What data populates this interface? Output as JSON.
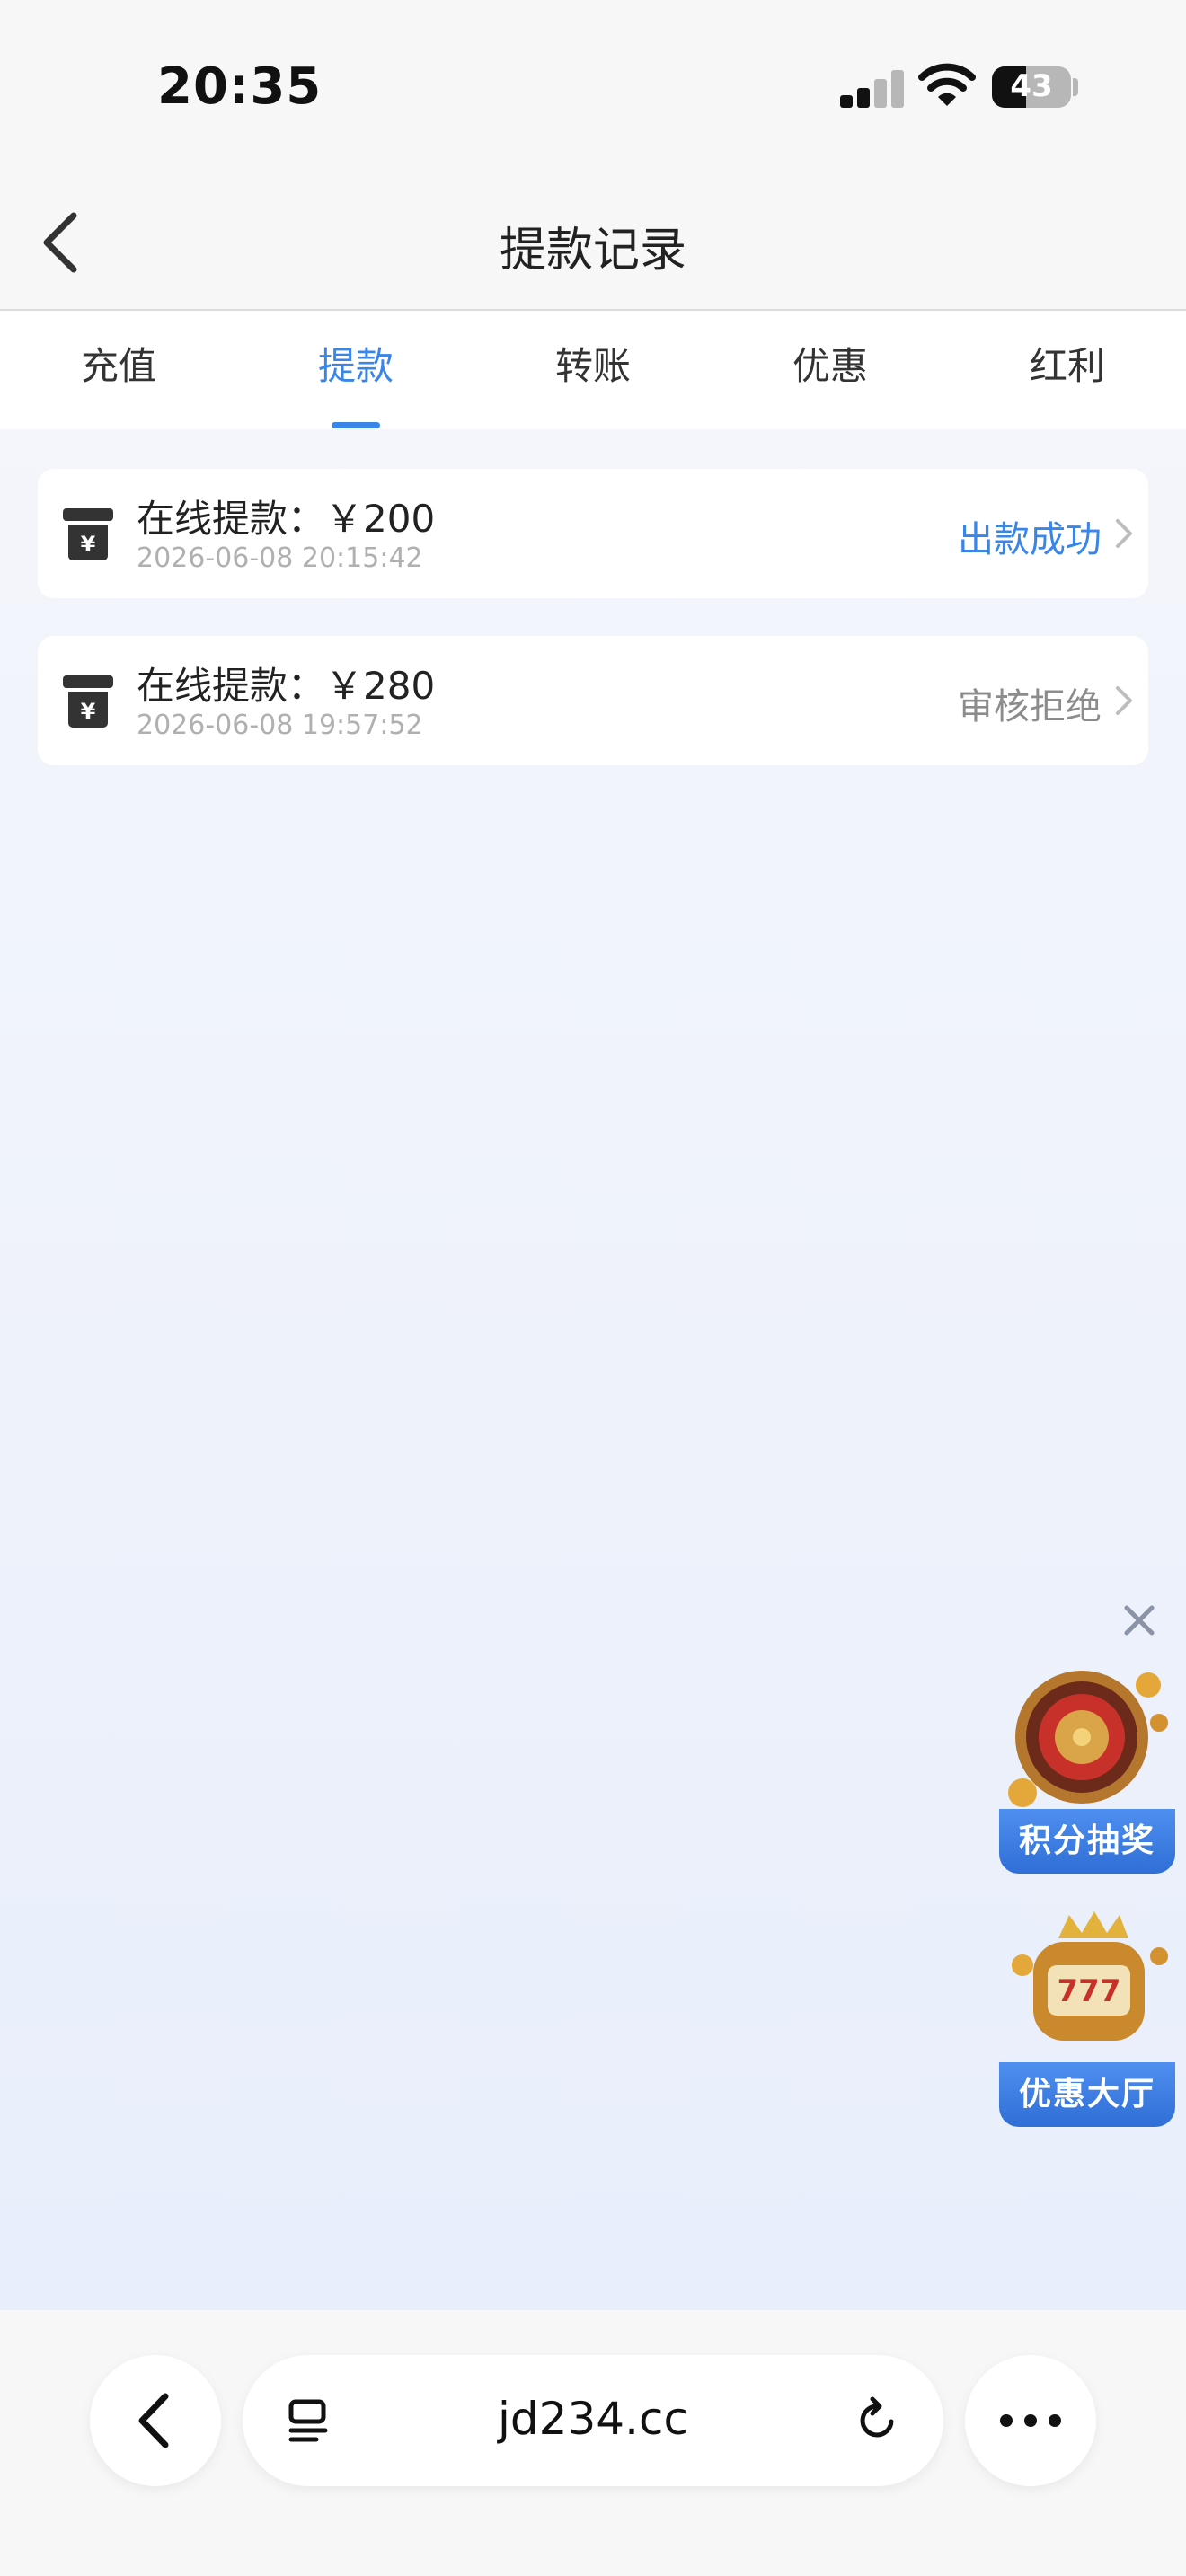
{
  "status_bar": {
    "time": "20:35",
    "battery": "43"
  },
  "nav": {
    "title": "提款记录"
  },
  "tabs": [
    {
      "label": "充值",
      "active": false
    },
    {
      "label": "提款",
      "active": true
    },
    {
      "label": "转账",
      "active": false
    },
    {
      "label": "优惠",
      "active": false
    },
    {
      "label": "红利",
      "active": false
    }
  ],
  "records": [
    {
      "label": "在线提款：￥200",
      "date": "2026-06-08 20:15:42",
      "status": "出款成功",
      "status_color": "#3a86e8"
    },
    {
      "label": "在线提款：￥280",
      "date": "2026-06-08 19:57:52",
      "status": "审核拒绝",
      "status_color": "#8c8c8c"
    }
  ],
  "promos": [
    {
      "label": "积分抽奖",
      "icon": "roulette-icon"
    },
    {
      "label": "优惠大厅",
      "icon": "slot-machine-icon"
    }
  ],
  "browser": {
    "url": "jd234.cc"
  },
  "colors": {
    "accent": "#3a86e8",
    "rejected": "#8c8c8c"
  }
}
